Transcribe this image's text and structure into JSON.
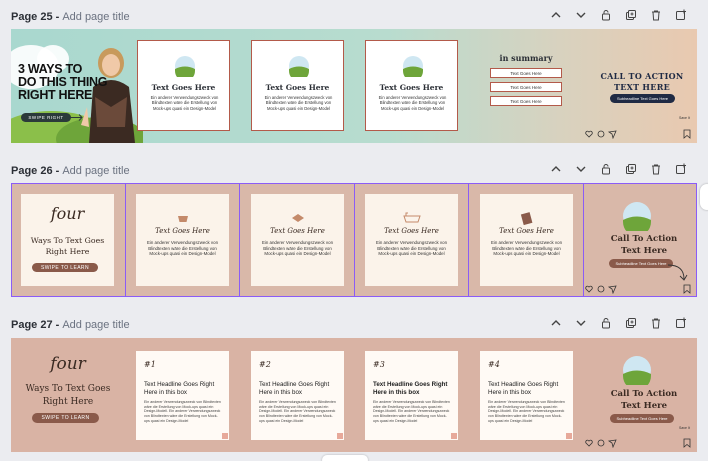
{
  "pages": [
    {
      "label": "Page 25 -",
      "add_title": "Add page title",
      "hero": {
        "lines": [
          "3 WAYS TO",
          "DO THIS THING",
          "RIGHT HERE"
        ],
        "swipe": "SWIPE RIGHT"
      },
      "cards": [
        {
          "title": "Text Goes Here",
          "body": "Ein anderer Verwendungszweck von Blindtexten wäre die Erstellung von Mock-ups quasi ein Design-Model"
        },
        {
          "title": "Text Goes Here",
          "body": "Ein anderer Verwendungszweck von Blindtexten wäre die Erstellung von Mock-ups quasi ein Design-Model"
        },
        {
          "title": "Text Goes Here",
          "body": "Ein anderer Verwendungszweck von Blindtexten wäre die Erstellung von Mock-ups quasi ein Design-Model"
        }
      ],
      "summary": {
        "title": "in summary",
        "items": [
          "Text Goes Here",
          "Text Goes Here",
          "Text Goes Here"
        ]
      },
      "cta": {
        "line1": "CALL TO ACTION",
        "line2": "TEXT HERE",
        "sub": "Subheadline Text Goes Here",
        "save": "Save It"
      }
    },
    {
      "label": "Page 26 -",
      "add_title": "Add page title",
      "intro": {
        "script": "four",
        "line1": "Ways To Text Goes",
        "line2": "Right Here",
        "button": "SWIPE TO LEARN"
      },
      "cards": [
        {
          "script": "Text Goes Here",
          "body": "Ein anderer Verwendungszweck von Blindtexten wäre die Erstellung von Mock-ups quasi ein Design-Model"
        },
        {
          "script": "Text Goes Here",
          "body": "Ein anderer Verwendungszweck von Blindtexten wäre die Erstellung von Mock-ups quasi ein Design-Model"
        },
        {
          "script": "Text Goes Here",
          "body": "Ein anderer Verwendungszweck von Blindtexten wäre die Erstellung von Mock-ups quasi ein Design-Model"
        },
        {
          "script": "Text Goes Here",
          "body": "Ein anderer Verwendungszweck von Blindtexten wäre die Erstellung von Mock-ups quasi ein Design-Model"
        }
      ],
      "cta": {
        "line1": "Call To Action",
        "line2": "Text Here",
        "sub": "Subheadline Text Goes Here"
      }
    },
    {
      "label": "Page 27 -",
      "add_title": "Add page title",
      "intro": {
        "script": "four",
        "line1": "Ways To Text Goes",
        "line2": "Right Here",
        "button": "SWIPE TO LEARN"
      },
      "cards": [
        {
          "num": "#1",
          "headline": "Text Headline Goes Right Here in this box",
          "body": "Ein anderer Verwendungszweck von Blindtexten wäre die Erstellung von Mock-ups quasi ein Design-Modell. Ein anderer Verwendungszweck von Blindtexten wäre die Erstellung von Mock-ups quasi ein Design-Model"
        },
        {
          "num": "#2",
          "headline": "Text Headline Goes Right Here in this box",
          "body": "Ein anderer Verwendungszweck von Blindtexten wäre die Erstellung von Mock-ups quasi ein Design-Modell. Ein anderer Verwendungszweck von Blindtexten wäre die Erstellung von Mock-ups quasi ein Design-Model"
        },
        {
          "num": "#3",
          "headline": "Text Headline Goes Right Here in this box",
          "body": "Ein anderer Verwendungszweck von Blindtexten wäre die Erstellung von Mock-ups quasi ein Design-Modell. Ein anderer Verwendungszweck von Blindtexten wäre die Erstellung von Mock-ups quasi ein Design-Model"
        },
        {
          "num": "#4",
          "headline": "Text Headline Goes Right Here in this box",
          "body": "Ein anderer Verwendungszweck von Blindtexten wäre die Erstellung von Mock-ups quasi ein Design-Modell. Ein anderer Verwendungszweck von Blindtexten wäre die Erstellung von Mock-ups quasi ein Design-Model"
        }
      ],
      "cta": {
        "line1": "Call To Action",
        "line2": "Text Here",
        "sub": "Subheadline Text Goes Here",
        "save": "Save It"
      }
    }
  ],
  "colors": {
    "selection": "#8b5cf6",
    "navy": "#1f2a44",
    "teal": "#a8d8cf",
    "pink": "#d8b4a6",
    "brown": "#8a5a4a"
  }
}
